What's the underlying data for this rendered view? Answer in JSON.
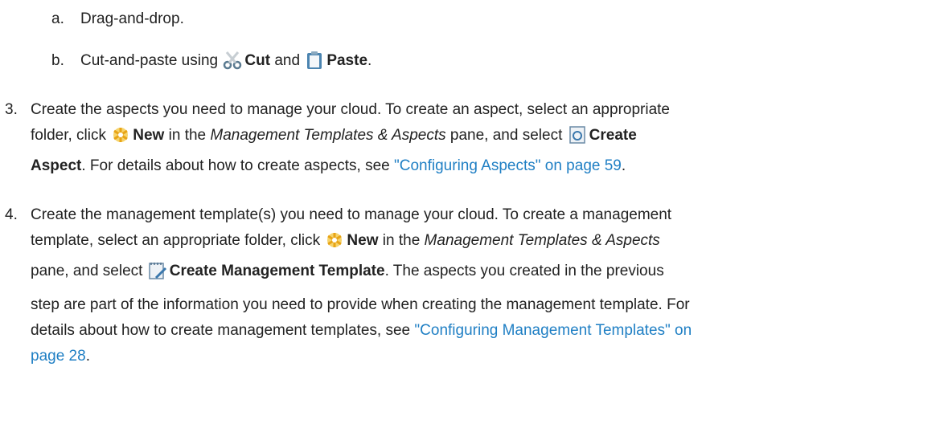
{
  "steps": {
    "sub_a": {
      "marker": "a.",
      "text": "Drag-and-drop."
    },
    "sub_b": {
      "marker": "b.",
      "prefix": "Cut-and-paste using ",
      "cut": "Cut",
      "and": " and ",
      "paste": "Paste",
      "end": "."
    },
    "step3": {
      "marker": "3.",
      "l1": "Create the aspects you need to manage your cloud. To create an aspect, select an appropriate",
      "l2_a": "folder, click ",
      "new": "New",
      "l2_b": " in the ",
      "pane": "Management Templates & Aspects",
      "l2_c": " pane, and select ",
      "create": "Create",
      "aspect": "Aspect",
      "l3_b": ". For details about how to create aspects, see ",
      "link": "\"Configuring Aspects\" on page 59",
      "end": "."
    },
    "step4": {
      "marker": "4.",
      "l1": "Create the management template(s) you need to manage your cloud. To create a management",
      "l2_a": "template, select an appropriate folder, click ",
      "new": "New",
      "l2_b": " in the ",
      "pane": "Management Templates & Aspects",
      "l3_a": "pane, and select ",
      "create_mt": "Create Management Template",
      "l3_b": ". The aspects you created in the previous",
      "l4": "step are part of the information you need to provide when creating the management template. For",
      "l5_a": "details about how to create management templates, see ",
      "link1": "\"Configuring Management Templates\" on",
      "link2": "page 28",
      "end": "."
    }
  },
  "icons": [
    "scissors-icon",
    "clipboard-icon",
    "new-star-icon",
    "create-aspect-icon",
    "create-management-template-icon"
  ],
  "colors": {
    "text": "#222222",
    "link": "#1f7fc4"
  }
}
